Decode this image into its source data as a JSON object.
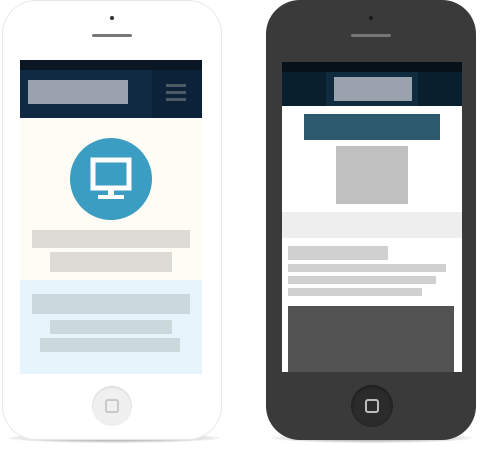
{
  "devices": [
    {
      "name": "phone-white",
      "body_color": "#ffffff",
      "screen": {
        "nav_color": "#0b2238",
        "hero_color": "#fdfdf5",
        "hero_icon": "monitor-icon",
        "hero_icon_bg": "#3a9dc1",
        "menu_icon": "hamburger-menu-icon",
        "section_color": "#e8f4fb"
      },
      "home_button_icon": "square-icon"
    },
    {
      "name": "phone-black",
      "body_color": "#3a3a3a",
      "screen": {
        "nav_color": "#0a1f2e",
        "title_bar_color": "#2d5a6e",
        "image_placeholder_color": "#c0c0c0",
        "dark_block_color": "#525252"
      },
      "home_button_icon": "square-icon"
    }
  ]
}
